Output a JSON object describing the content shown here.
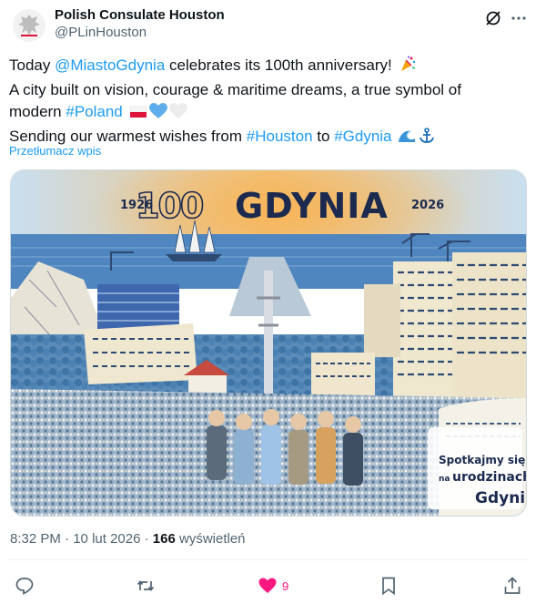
{
  "author": {
    "name": "Polish Consulate Houston",
    "handle": "@PLinHouston"
  },
  "tweet": {
    "line1_pre": "Today ",
    "mention": "@MiastoGdynia",
    "line1_post": " celebrates its 100th anniversary!",
    "line2": "A city built on vision, courage & maritime dreams, a true symbol of",
    "line3_pre": "modern ",
    "hashtag_poland": "#Poland",
    "line4_pre": "Sending our warmest wishes from ",
    "hashtag_houston": "#Houston",
    "line4_mid": " to ",
    "hashtag_gdynia": "#Gdynia",
    "emojis": [
      "party-popper",
      "flag-poland",
      "blue-heart",
      "white-heart",
      "wave",
      "anchor"
    ]
  },
  "translate_label": "Przetłumacz wpis",
  "media": {
    "year_left": "1926",
    "year_right": "2026",
    "logo_number": "100",
    "logo_city": "GDYNIA",
    "badge_line1": "Spotkajmy się",
    "badge_small": "na",
    "badge_line2": "urodzinach",
    "badge_line3": "Gdyni"
  },
  "meta": {
    "time": "8:32 PM",
    "separator": " · ",
    "date": "10 lut 2026",
    "views_count": "166",
    "views_label": " wyświetleń"
  },
  "actions": {
    "likes": "9"
  },
  "colors": {
    "link": "#1d9bf0",
    "like": "#f91880",
    "secondary_text": "#536471",
    "logo_navy": "#1b2a4e"
  }
}
